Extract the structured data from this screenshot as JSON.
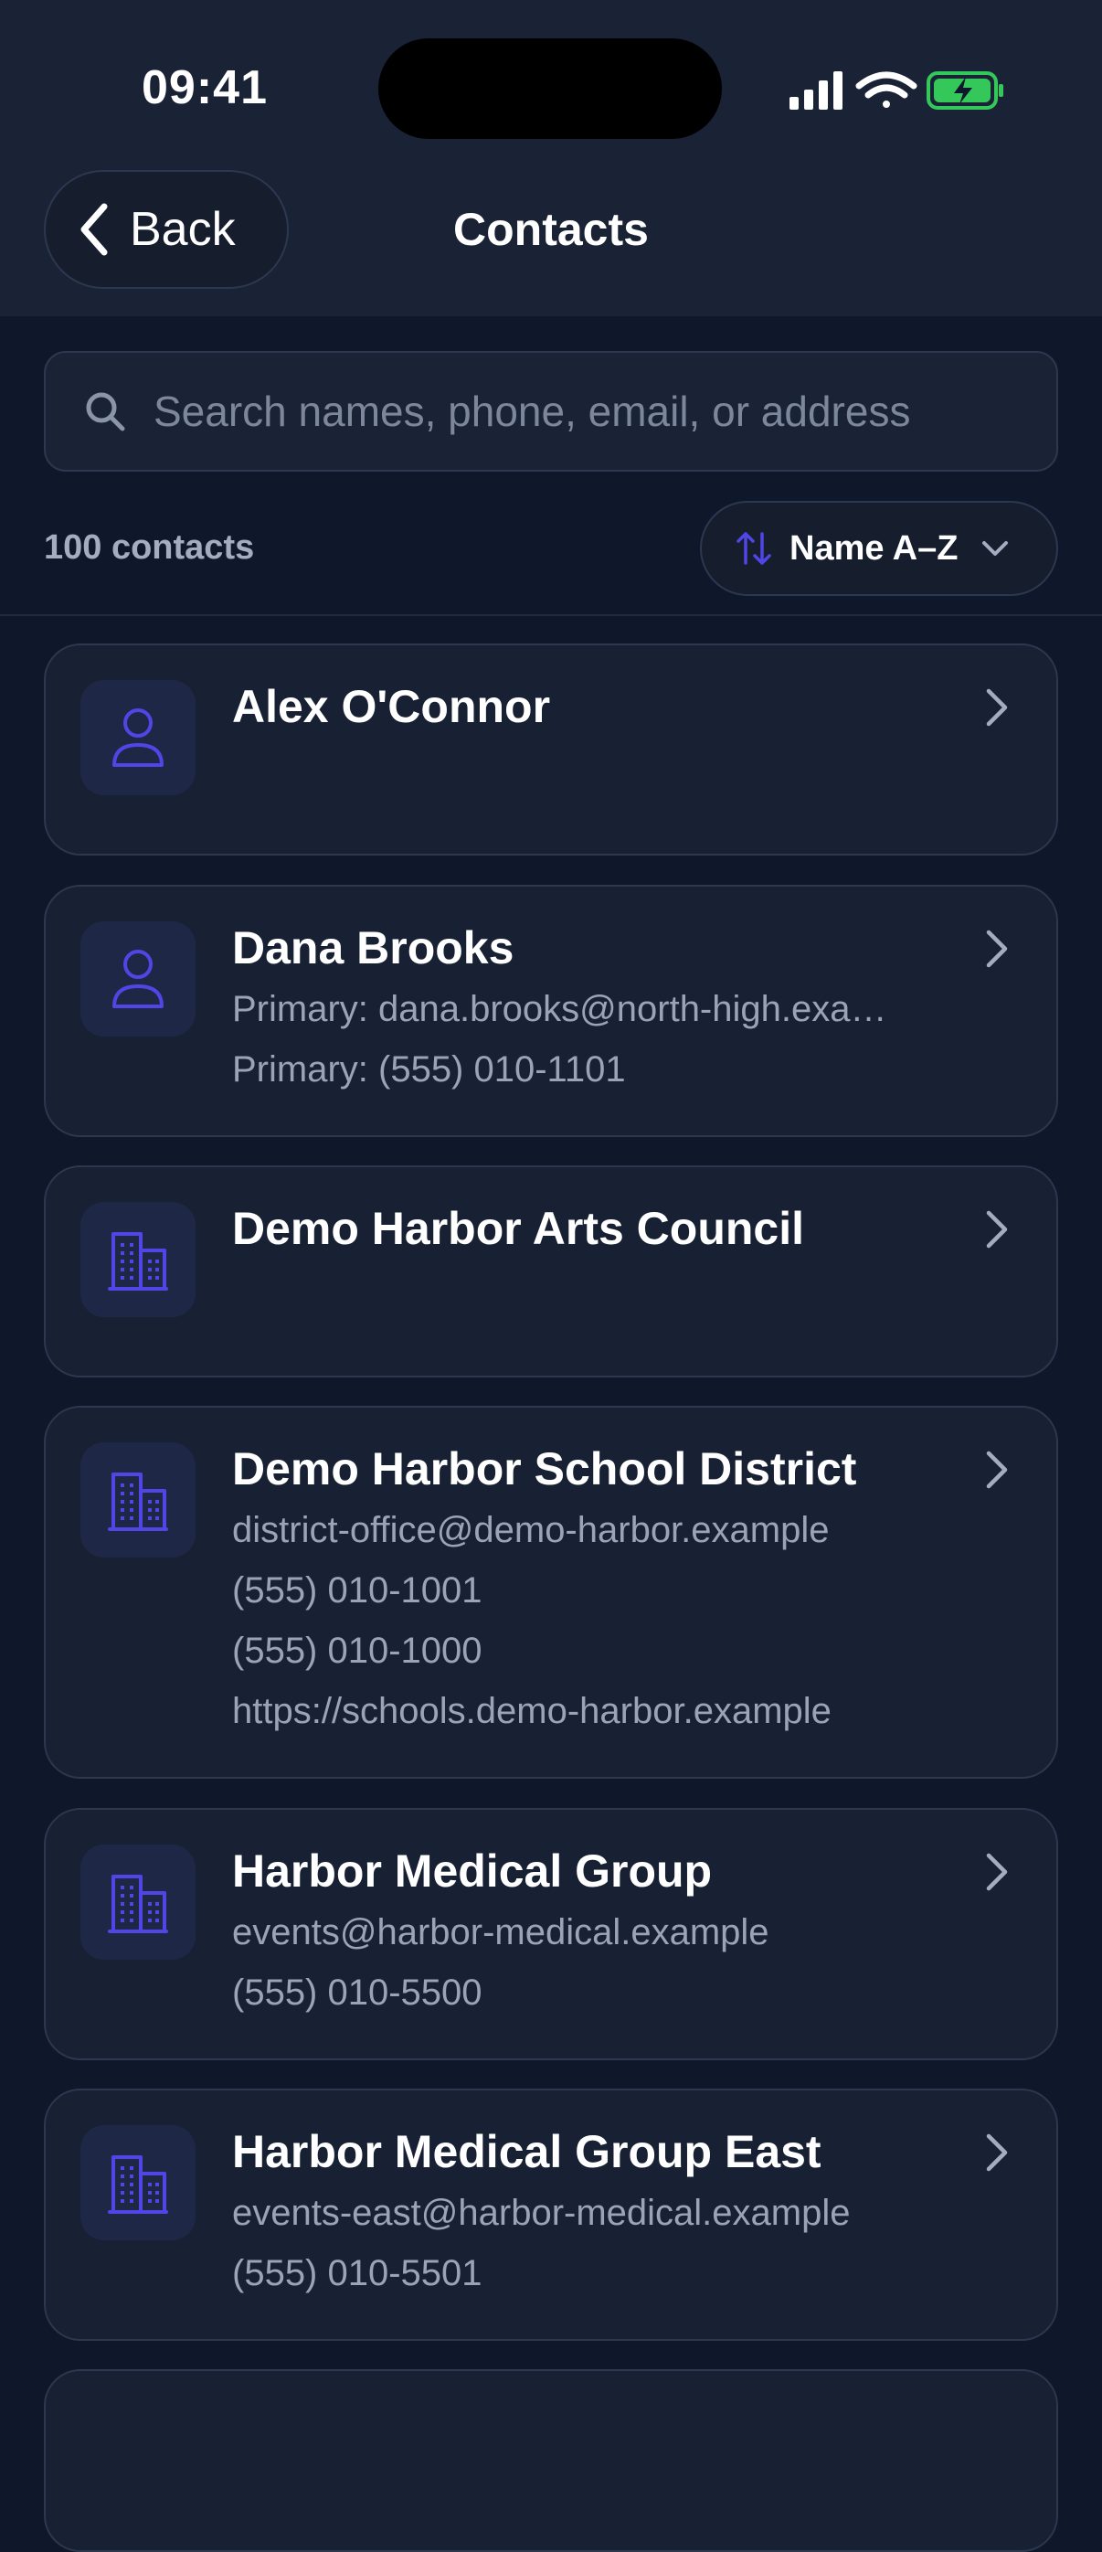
{
  "status": {
    "time": "09:41"
  },
  "nav": {
    "back_label": "Back",
    "title": "Contacts"
  },
  "search": {
    "placeholder": "Search names, phone, email, or address"
  },
  "list_meta": {
    "count_label": "100 contacts",
    "sort_label": "Name A–Z"
  },
  "colors": {
    "accent": "#4f46e5",
    "background": "#0f172a",
    "card": "#182133",
    "battery": "#34c759"
  },
  "contacts": [
    {
      "name": "Alex O'Connor",
      "icon": "person-icon",
      "lines": []
    },
    {
      "name": "Dana Brooks",
      "icon": "person-icon",
      "lines": [
        "Primary: dana.brooks@north-high.exa…",
        "Primary: (555) 010-1101"
      ]
    },
    {
      "name": "Demo Harbor Arts Council",
      "icon": "building-icon",
      "lines": []
    },
    {
      "name": "Demo Harbor School District",
      "icon": "building-icon",
      "lines": [
        "district-office@demo-harbor.example",
        "(555) 010-1001",
        "(555) 010-1000",
        "https://schools.demo-harbor.example"
      ]
    },
    {
      "name": "Harbor Medical Group",
      "icon": "building-icon",
      "lines": [
        "events@harbor-medical.example",
        "(555) 010-5500"
      ]
    },
    {
      "name": "Harbor Medical Group East",
      "icon": "building-icon",
      "lines": [
        "events-east@harbor-medical.example",
        "(555) 010-5501"
      ]
    }
  ]
}
